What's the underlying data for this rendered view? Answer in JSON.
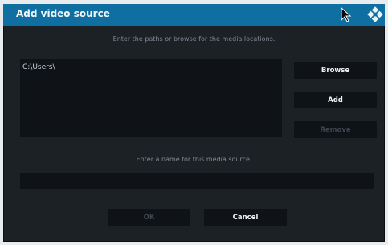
{
  "dialog": {
    "title": "Add video source",
    "paths_instruction": "Enter the paths or browse for the media locations.",
    "paths": [
      "C:\\Users\\"
    ],
    "buttons": {
      "browse": "Browse",
      "add": "Add",
      "remove": "Remove"
    },
    "name_instruction": "Enter a name for this media source.",
    "name_value": "",
    "ok_label": "OK",
    "cancel_label": "Cancel"
  },
  "colors": {
    "titlebar": "#0e6fa0",
    "dialog_bg": "#1c2126",
    "field_bg": "#0f1317",
    "disabled_text": "#3e4650"
  },
  "icons": [
    "mouse-cursor-icon",
    "kodi-logo-icon"
  ]
}
